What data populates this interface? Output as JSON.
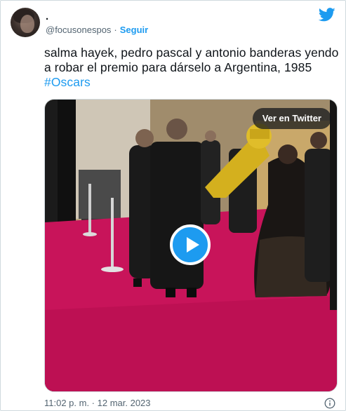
{
  "tweet": {
    "display_name": ".",
    "handle": "@focusonespos",
    "separator": "·",
    "follow_label": "Seguir",
    "text_main": "salma hayek, pedro pascal y antonio banderas yendo a robar el premio para dárselo a Argentina, 1985 ",
    "hashtag": "#Oscars",
    "timestamp": "11:02 p. m. · 12 mar. 2023"
  },
  "media": {
    "overlay_button_label": "Ver en Twitter",
    "play_icon": "play-icon"
  },
  "icons": {
    "brand": "twitter-bird-icon",
    "info": "info-icon"
  },
  "colors": {
    "accent": "#1d9bf0",
    "text": "#0f1419",
    "secondary": "#536471",
    "border": "#cfd9de",
    "carpet": "#c8145a"
  }
}
